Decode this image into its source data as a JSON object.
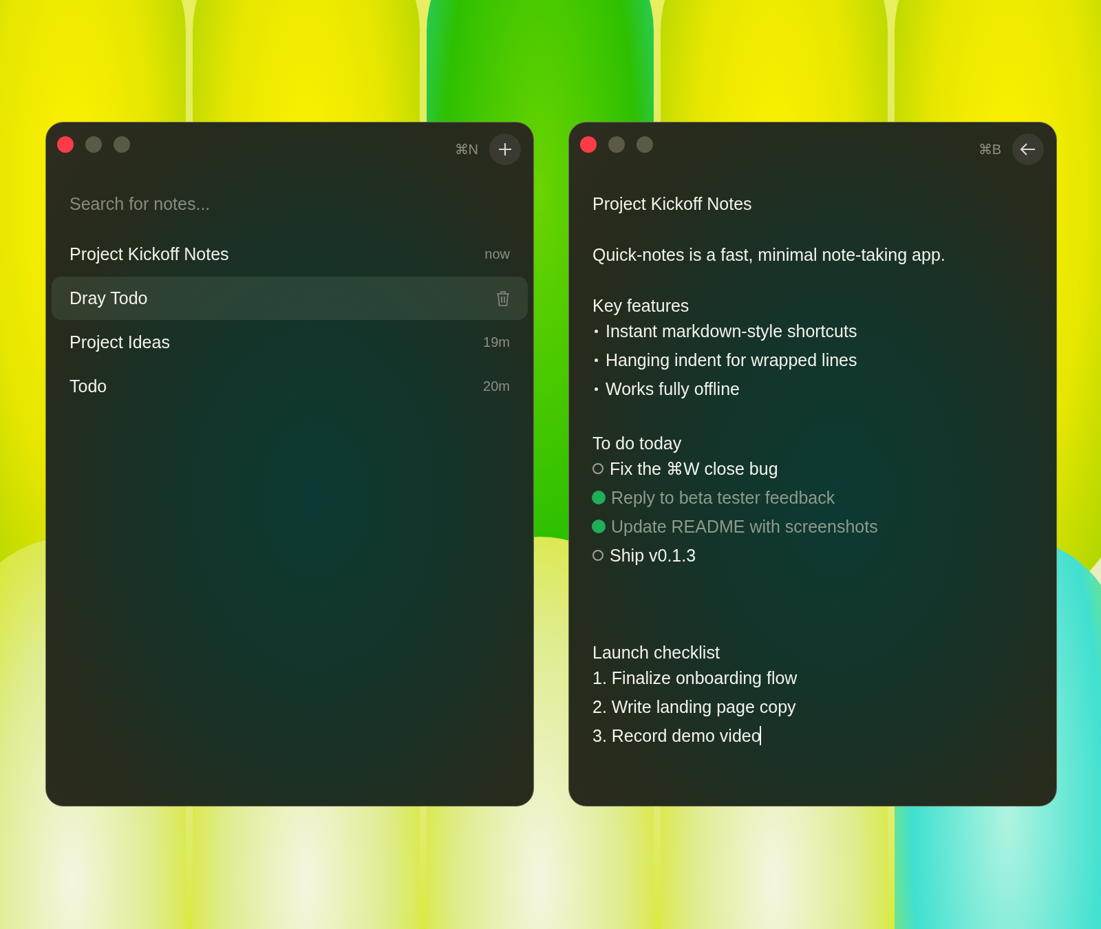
{
  "windows": [
    {
      "kind": "list",
      "shortcut": "⌘N",
      "search": {
        "placeholder": "Search for notes..."
      },
      "notes": [
        {
          "title": "Project Kickoff Notes",
          "time": "now",
          "selected": false
        },
        {
          "title": "Dray Todo",
          "selected": true
        },
        {
          "title": "Project Ideas",
          "time": "19m",
          "selected": false
        },
        {
          "title": "Todo",
          "time": "20m",
          "selected": false
        }
      ]
    },
    {
      "kind": "editor",
      "shortcut": "⌘B",
      "title": "Project Kickoff Notes",
      "body": [
        {
          "kind": "paragraph",
          "text": "Quick-notes is a fast, minimal note-taking app."
        },
        {
          "kind": "bullet_list",
          "heading": "Key features",
          "items": [
            {
              "text": "Instant markdown-style shortcuts"
            },
            {
              "text": "Hanging indent for wrapped lines"
            },
            {
              "text": "Works fully offline"
            }
          ]
        },
        {
          "kind": "todo_list",
          "heading": "To do today",
          "items": [
            {
              "text": "Fix the ⌘W close bug",
              "checked": false
            },
            {
              "text": "Reply to beta tester feedback",
              "checked": true
            },
            {
              "text": "Update README with screenshots",
              "checked": true
            },
            {
              "text": "Ship v0.1.3",
              "checked": false
            }
          ]
        },
        {
          "kind": "numbered_list",
          "heading": "Launch checklist",
          "items": [
            {
              "number": "1.",
              "text": "Finalize onboarding flow",
              "cursor": false
            },
            {
              "number": "2.",
              "text": "Write landing page copy",
              "cursor": false
            },
            {
              "number": "3.",
              "text": "Record demo video",
              "cursor": true
            }
          ]
        }
      ]
    }
  ]
}
